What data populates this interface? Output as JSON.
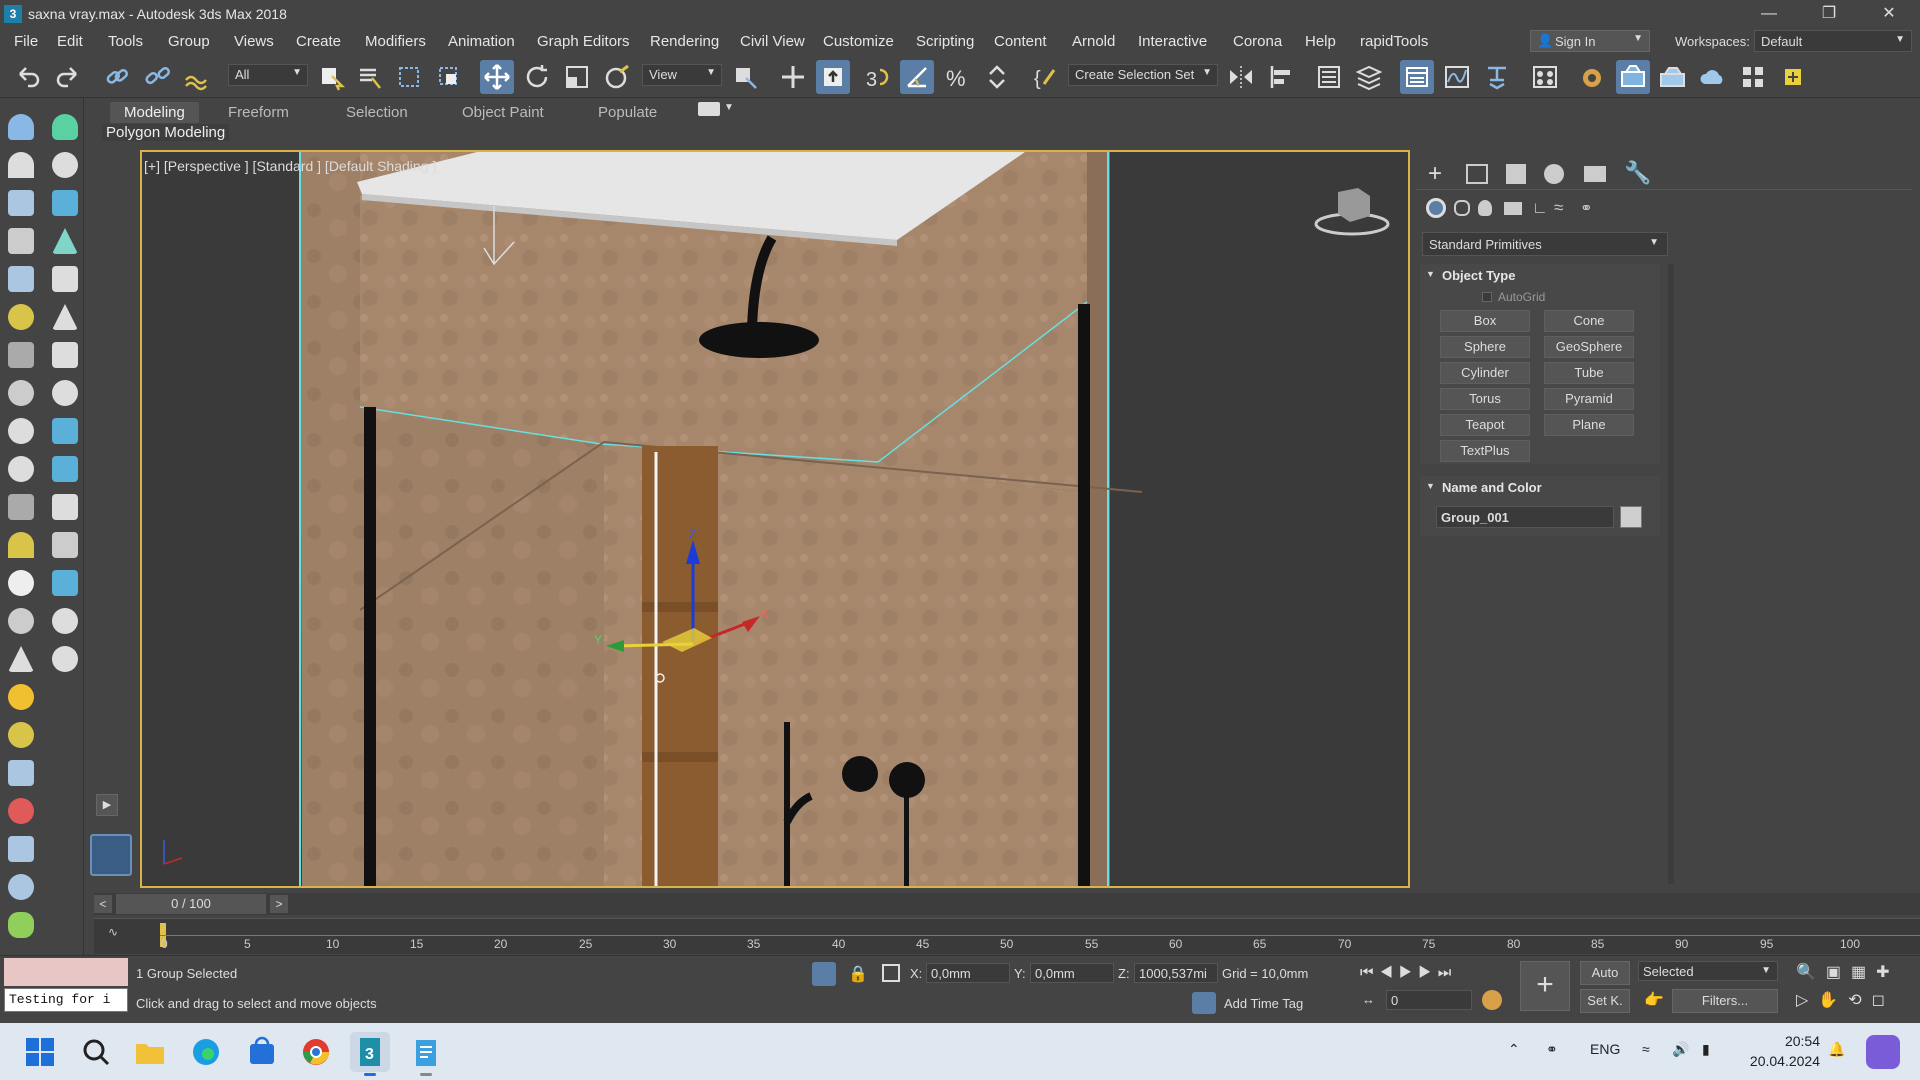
{
  "window": {
    "title": "saxna vray.max - Autodesk 3ds Max 2018",
    "app_icon_letter": "3",
    "controls": [
      "minimize-icon",
      "restore-icon",
      "close-icon"
    ]
  },
  "menu": {
    "items": [
      "File",
      "Edit",
      "Tools",
      "Group",
      "Views",
      "Create",
      "Modifiers",
      "Animation",
      "Graph Editors",
      "Rendering",
      "Civil View",
      "Customize",
      "Scripting",
      "Content",
      "Arnold",
      "Interactive",
      "Corona",
      "Help",
      "rapidTools"
    ],
    "sign_in": "Sign In",
    "workspaces_label": "Workspaces:",
    "workspace_value": "Default"
  },
  "toolbar": {
    "selection_filter": "All",
    "ref_coord": "View",
    "named_selection": "Create Selection Set"
  },
  "ribbon": {
    "tabs": [
      "Modeling",
      "Freeform",
      "Selection",
      "Object Paint",
      "Populate"
    ],
    "active_tab": "Modeling",
    "subtab": "Polygon Modeling"
  },
  "viewport": {
    "label": "[+] [Perspective ] [Standard ] [Default Shading ]",
    "gizmo_axes": [
      "X",
      "Y",
      "Z"
    ]
  },
  "command_panel": {
    "category": "Standard Primitives",
    "object_type_title": "Object Type",
    "autogrid": "AutoGrid",
    "buttons": [
      "Box",
      "Cone",
      "Sphere",
      "GeoSphere",
      "Cylinder",
      "Tube",
      "Torus",
      "Pyramid",
      "Teapot",
      "Plane",
      "TextPlus"
    ],
    "name_color_title": "Name and Color",
    "object_name": "Group_001",
    "object_color": "#cfcfcf"
  },
  "timeline": {
    "frame_display": "0 / 100",
    "ticks": [
      "0",
      "5",
      "10",
      "15",
      "20",
      "25",
      "30",
      "35",
      "40",
      "45",
      "50",
      "55",
      "60",
      "65",
      "70",
      "75",
      "80",
      "85",
      "90",
      "95",
      "100"
    ]
  },
  "status": {
    "maxscript_text": "Testing for i",
    "selection_info": "1 Group Selected",
    "prompt": "Click and drag to select and move objects",
    "x_label": "X:",
    "x_value": "0,0mm",
    "y_label": "Y:",
    "y_value": "0,0mm",
    "z_label": "Z:",
    "z_value": "1000,537mi",
    "grid": "Grid = 10,0mm",
    "add_time_tag": "Add Time Tag",
    "auto_key": "Auto",
    "set_key": "Set K.",
    "key_filter": "Selected",
    "filters": "Filters...",
    "frame_value": "0"
  },
  "taskbar": {
    "language": "ENG",
    "time": "20:54",
    "date": "20.04.2024"
  },
  "colors": {
    "selection_outline": "#66e0e0",
    "viewport_border": "#d9b34a",
    "active_tool": "#5a7ea6",
    "wall_texture": "#a6876c"
  }
}
